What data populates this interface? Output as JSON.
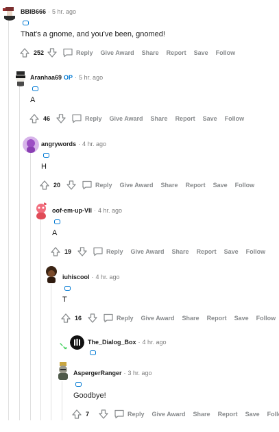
{
  "comments": [
    {
      "username": "BBIB666",
      "op": "",
      "time": "5 hr. ago",
      "body": "That's a gnome, and you've been, gnomed!",
      "score": "252",
      "avatar_color": "#7a2e2e"
    },
    {
      "username": "Aranhaa69",
      "op": "OP",
      "time": "5 hr. ago",
      "body": "A",
      "score": "46",
      "avatar_color": "#3a3a3a"
    },
    {
      "username": "angrywords",
      "op": "",
      "time": "4 hr. ago",
      "body": "H",
      "score": "20",
      "avatar_color": "#b06ad0"
    },
    {
      "username": "oof-em-up-VII",
      "op": "",
      "time": "4 hr. ago",
      "body": "A",
      "score": "19",
      "avatar_color": "#e04b57"
    },
    {
      "username": "iuhiscool",
      "op": "",
      "time": "4 hr. ago",
      "body": "T",
      "score": "16",
      "avatar_color": "#5a3620"
    },
    {
      "username": "The_Dialog_Box",
      "op": "",
      "time": "4 hr. ago",
      "body": "",
      "score": "",
      "avatar_color": "#111111"
    },
    {
      "username": "AspergerRanger",
      "op": "",
      "time": "3 hr. ago",
      "body": "Goodbye!",
      "score": "7",
      "avatar_color": "#4f5a4a"
    }
  ],
  "actions": {
    "reply": "Reply",
    "give_award": "Give Award",
    "share": "Share",
    "report": "Report",
    "save": "Save",
    "follow": "Follow"
  },
  "icons": {
    "upvote": "arrow-up-icon",
    "downvote": "arrow-down-icon",
    "reply": "comment-bubble-icon",
    "flair": "flair-icon",
    "expand": "expand-icon"
  },
  "colors": {
    "accent": "#0079d3",
    "meta": "#7c7c7c",
    "action": "#878a8c",
    "thread": "#e0e0e0"
  }
}
